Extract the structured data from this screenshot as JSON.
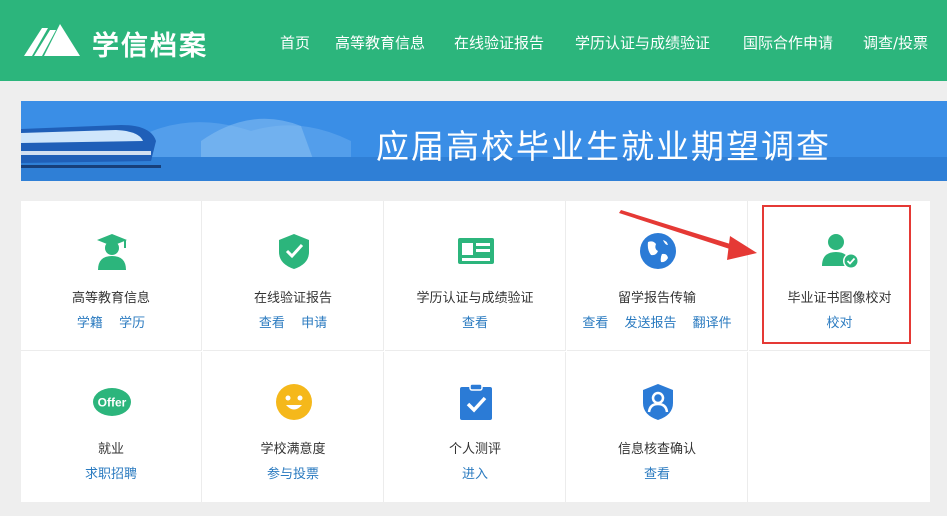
{
  "header": {
    "brand": "学信档案",
    "nav": [
      "首页",
      "高等教育信息",
      "在线验证报告",
      "学历认证与成绩验证",
      "国际合作申请",
      "调查/投票"
    ]
  },
  "banner": {
    "title": "应届高校毕业生就业期望调查"
  },
  "grid": {
    "cells": [
      {
        "title": "高等教育信息",
        "links": [
          "学籍",
          "学历"
        ],
        "icon": "graduate-icon"
      },
      {
        "title": "在线验证报告",
        "links": [
          "查看",
          "申请"
        ],
        "icon": "shield-check-icon"
      },
      {
        "title": "学历认证与成绩验证",
        "links": [
          "查看"
        ],
        "icon": "id-card-icon"
      },
      {
        "title": "留学报告传输",
        "links": [
          "查看",
          "发送报告",
          "翻译件"
        ],
        "icon": "globe-icon"
      },
      {
        "title": "毕业证书图像校对",
        "links": [
          "校对"
        ],
        "icon": "user-check-icon"
      },
      {
        "title": "就业",
        "links": [
          "求职招聘"
        ],
        "icon": "offer-icon",
        "icon_text": "Offer"
      },
      {
        "title": "学校满意度",
        "links": [
          "参与投票"
        ],
        "icon": "smiley-icon"
      },
      {
        "title": "个人测评",
        "links": [
          "进入"
        ],
        "icon": "clipboard-check-icon"
      },
      {
        "title": "信息核查确认",
        "links": [
          "查看"
        ],
        "icon": "shield-user-icon"
      },
      {
        "title": "",
        "links": [],
        "icon": ""
      }
    ]
  },
  "colors": {
    "brand_green": "#2cb57c",
    "banner_blue": "#3a8ee6",
    "link_blue": "#2b7bc0",
    "highlight_red": "#e53935"
  }
}
